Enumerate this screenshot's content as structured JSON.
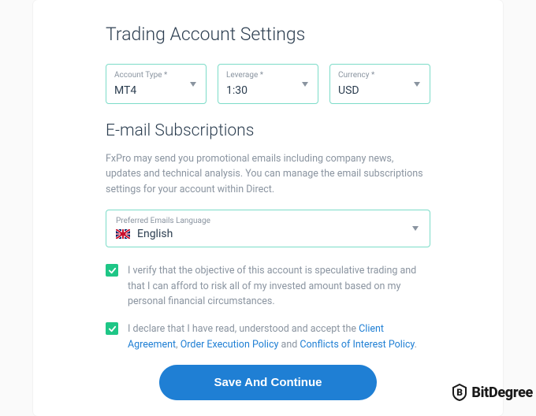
{
  "heading": "Trading Account Settings",
  "selects": {
    "accountType": {
      "label": "Account Type *",
      "value": "MT4"
    },
    "leverage": {
      "label": "Leverage *",
      "value": "1:30"
    },
    "currency": {
      "label": "Currency *",
      "value": "USD"
    }
  },
  "emailHeading": "E-mail Subscriptions",
  "emailInfo": "FxPro may send you promotional emails including company news, updates and technical analysis. You can manage the email subscriptions settings for your account within Direct.",
  "languageSelect": {
    "label": "Preferred Emails Language",
    "value": "English"
  },
  "checkbox1": "I verify that the objective of this account is speculative trading and that I can afford to risk all of my invested amount based on my personal financial circumstances.",
  "checkbox2": {
    "prefix": "I declare that I have read, understood and accept the ",
    "link1": "Client Agreement",
    "sep1": ", ",
    "link2": "Order Execution Policy",
    "sep2": " and ",
    "link3": "Conflicts of Interest Policy",
    "suffix": "."
  },
  "submit": "Save And Continue",
  "watermark": "BitDegree",
  "colors": {
    "accentBorder": "#7CDCC8",
    "checkGreen": "#1EC686",
    "link": "#1f7fd4",
    "btn": "#1f7fd4"
  }
}
